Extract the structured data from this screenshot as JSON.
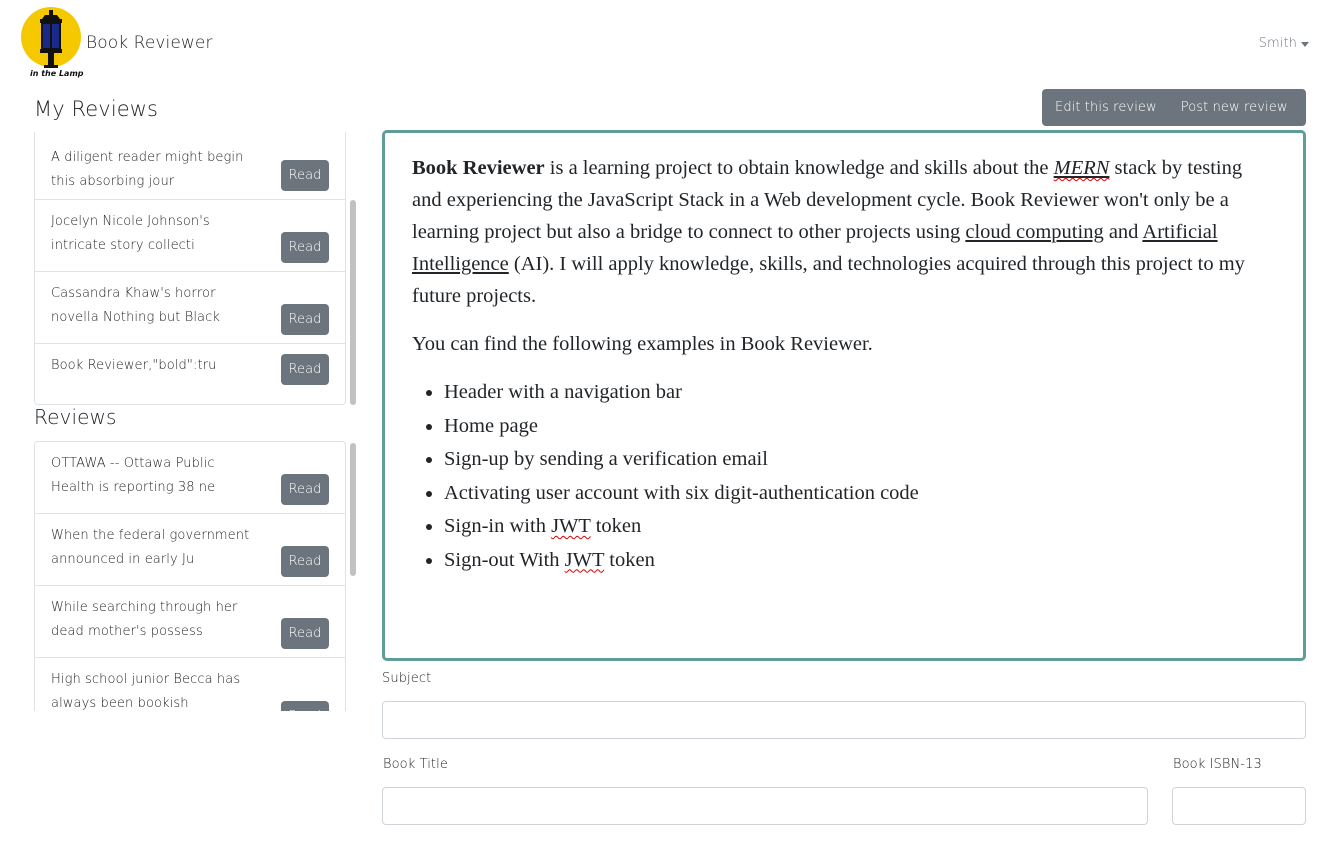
{
  "header": {
    "logo_text": "in the Lamp",
    "brand": "Book Reviewer",
    "user": "Smith"
  },
  "my_reviews": {
    "title": "My Reviews",
    "items": [
      {
        "text": "A diligent reader might begin this absorbing jour",
        "button": "Read"
      },
      {
        "text": "Jocelyn Nicole Johnson's intricate story collecti",
        "button": "Read"
      },
      {
        "text": "Cassandra Khaw's horror novella Nothing but Black",
        "button": "Read"
      },
      {
        "text": "Book Reviewer,\"bold\":tru",
        "button": "Read"
      }
    ]
  },
  "reviews": {
    "title": "Reviews",
    "items": [
      {
        "text": "OTTAWA -- Ottawa Public Health is reporting 38 ne",
        "button": "Read"
      },
      {
        "text": "When the federal government announced in early Ju",
        "button": "Read"
      },
      {
        "text": "While searching through her dead mother's possess",
        "button": "Read"
      },
      {
        "text": "High school junior Becca has always been bookish",
        "button": "Read"
      }
    ]
  },
  "actions": {
    "edit": "Edit this review",
    "post": "Post new review"
  },
  "content": {
    "p1_bold": "Book Reviewer",
    "p1_a": " is a learning project to obtain knowledge and skills about the ",
    "p1_link_mern": "MERN",
    "p1_b": " stack by testing and experiencing the JavaScript Stack in a Web development cycle. Book Reviewer won't only be a learning project but also a bridge to connect to other projects using ",
    "p1_link_cloud": "cloud computing",
    "p1_c": " and ",
    "p1_link_ai": "Artificial Intelligence",
    "p1_d": " (AI). I will apply knowledge, skills, and technologies acquired through this project to my future projects.",
    "p2": "You can find the following examples in Book Reviewer.",
    "list": {
      "item1": "Header with a navigation bar",
      "item2": "Home page",
      "item3": "Sign-up by sending a verification email",
      "item4": "Activating user account with six digit-authentication code",
      "item5_a": "Sign-in with ",
      "item5_jwt": "JWT",
      "item5_b": " token",
      "item6_a": "Sign-out With ",
      "item6_jwt": "JWT",
      "item6_b": " token"
    }
  },
  "form": {
    "subject_label": "Subject",
    "subject_value": "",
    "title_label": "Book Title",
    "title_value": "",
    "isbn_label": "Book ISBN-13",
    "isbn_value": ""
  },
  "colors": {
    "card_border": "#5f9e98",
    "button_bg": "#6c757d",
    "logo_bg": "#f5c800"
  }
}
